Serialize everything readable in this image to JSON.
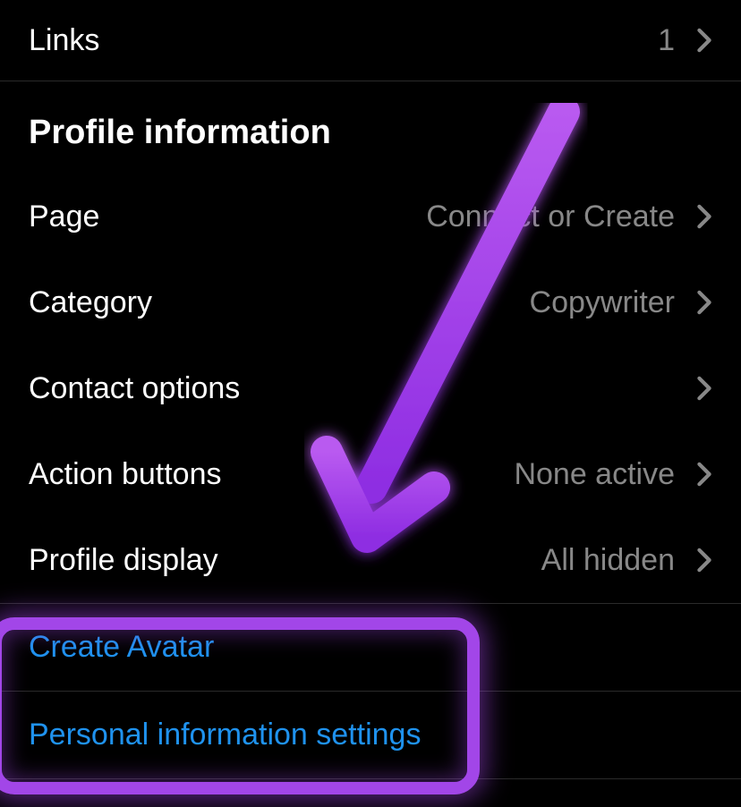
{
  "links_row": {
    "label": "Links",
    "value": "1"
  },
  "section": {
    "title": "Profile information"
  },
  "rows": {
    "page": {
      "label": "Page",
      "value": "Connect or Create"
    },
    "category": {
      "label": "Category",
      "value": "Copywriter"
    },
    "contact": {
      "label": "Contact options",
      "value": ""
    },
    "action": {
      "label": "Action buttons",
      "value": "None active"
    },
    "display": {
      "label": "Profile display",
      "value": "All hidden"
    }
  },
  "link_rows": {
    "avatar": "Create Avatar",
    "personal": "Personal information settings"
  },
  "colors": {
    "accent": "#1f92ee",
    "annotation": "#a246e8"
  }
}
